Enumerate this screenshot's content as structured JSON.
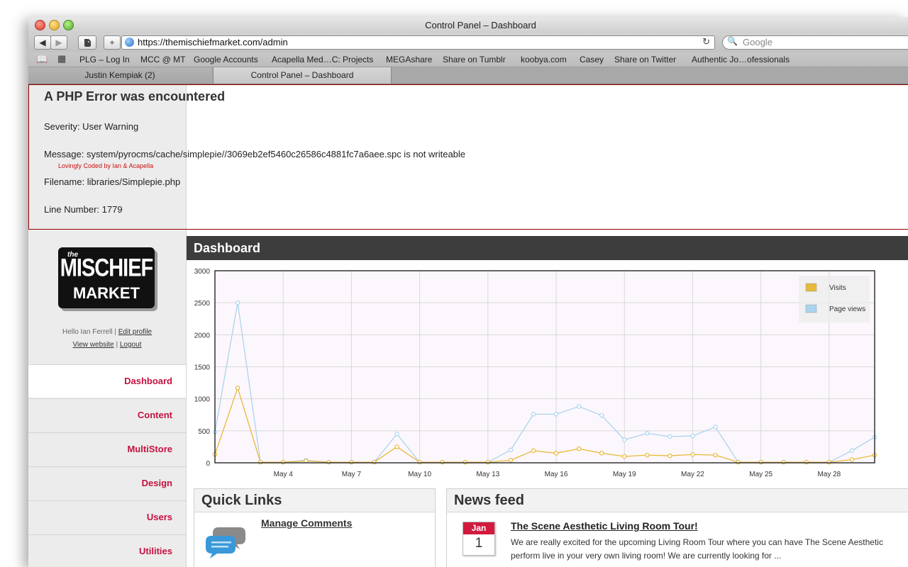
{
  "window": {
    "title": "Control Panel – Dashboard"
  },
  "toolbar": {
    "back_icon": "◀",
    "forward_icon": "▶",
    "add_icon": "+",
    "url": "https://themischiefmarket.com/admin",
    "reload_icon": "↻",
    "search_icon": "🔍",
    "search_placeholder": "Google"
  },
  "bookmarks": [
    "PLG – Log In",
    "MCC @ MT",
    "Google Accounts",
    "Acapella Med…C: Projects",
    "MEGAshare",
    "Share on Tumblr",
    "koobya.com",
    "Casey",
    "Share on Twitter",
    "Authentic Jo…ofessionals"
  ],
  "tabs": [
    "Justin Kempiak (2)",
    "Control Panel – Dashboard"
  ],
  "php_error": {
    "title": "A PHP Error was encountered",
    "severity": "Severity: User Warning",
    "message": "Message: system/pyrocms/cache/simplepie//3069eb2ef5460c26586c4881fc7a6aee.spc is not writeable",
    "filename": "Filename: libraries/Simplepie.php",
    "line": "Line Number: 1779"
  },
  "coded_by": "Lovingly Coded by Ian & Acapella",
  "logo": {
    "the": "the",
    "line1": "MISCHIEF",
    "line2": "MARKET"
  },
  "user": {
    "hello": "Hello Ian Ferrell",
    "edit_profile": "Edit profile",
    "view_website": "View website",
    "logout": "Logout",
    "sep": "|"
  },
  "nav": [
    "Dashboard",
    "Content",
    "MultiStore",
    "Design",
    "Users",
    "Utilities"
  ],
  "dashboard": {
    "title": "Dashboard"
  },
  "chart_data": {
    "type": "line",
    "title": "",
    "xlabel": "",
    "ylabel": "",
    "ylim": [
      0,
      3000
    ],
    "yticks": [
      0,
      500,
      1000,
      1500,
      2000,
      2500,
      3000
    ],
    "xtick_labels": [
      "May 4",
      "May 7",
      "May 10",
      "May 13",
      "May 16",
      "May 19",
      "May 22",
      "May 25",
      "May 28"
    ],
    "x": [
      "May 1",
      "May 2",
      "May 3",
      "May 4",
      "May 5",
      "May 6",
      "May 7",
      "May 8",
      "May 9",
      "May 10",
      "May 11",
      "May 12",
      "May 13",
      "May 14",
      "May 15",
      "May 16",
      "May 17",
      "May 18",
      "May 19",
      "May 20",
      "May 21",
      "May 22",
      "May 23",
      "May 24",
      "May 25",
      "May 26",
      "May 27",
      "May 28",
      "May 29",
      "May 30"
    ],
    "series": [
      {
        "name": "Visits",
        "color": "#e8b93a",
        "values": [
          130,
          1170,
          10,
          10,
          30,
          10,
          10,
          10,
          250,
          10,
          10,
          10,
          10,
          40,
          190,
          150,
          220,
          150,
          100,
          120,
          110,
          130,
          120,
          10,
          10,
          10,
          10,
          10,
          50,
          120
        ]
      },
      {
        "name": "Page views",
        "color": "#aad4ee",
        "values": [
          480,
          2500,
          10,
          10,
          40,
          10,
          10,
          10,
          450,
          10,
          10,
          10,
          10,
          200,
          760,
          760,
          880,
          740,
          360,
          460,
          410,
          420,
          560,
          10,
          10,
          10,
          10,
          10,
          190,
          400
        ]
      }
    ],
    "grid": true,
    "legend": "top-right",
    "plot_background": "#fcf7fc"
  },
  "quick_links": {
    "title": "Quick Links",
    "manage_comments": "Manage Comments"
  },
  "news_feed": {
    "title": "News feed",
    "month": "Jan",
    "day": "1",
    "headline": "The Scene Aesthetic Living Room Tour!",
    "body": "We are really excited for the upcoming Living Room Tour where you can have The Scene Aesthetic perform live in your very own living room! We are currently looking for ..."
  },
  "colors": {
    "nav_accent": "#c4123f",
    "error_border": "#990000",
    "header_dark": "#3d3d3d"
  }
}
